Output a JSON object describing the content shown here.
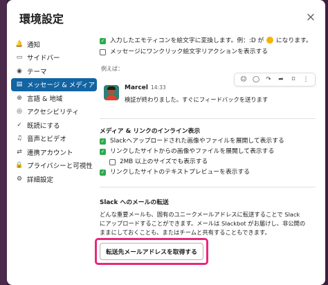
{
  "modal": {
    "title": "環境設定",
    "close_icon": "×"
  },
  "sidebar": {
    "items": [
      {
        "icon": "🔔",
        "label": "通知",
        "active": false
      },
      {
        "icon": "▭",
        "label": "サイドバー",
        "active": false
      },
      {
        "icon": "◉",
        "label": "テーマ",
        "active": false
      },
      {
        "icon": "▤",
        "label": "メッセージ & メディア",
        "active": true
      },
      {
        "icon": "⊕",
        "label": "言語 & 地域",
        "active": false
      },
      {
        "icon": "◎",
        "label": "アクセシビリティ",
        "active": false
      },
      {
        "icon": "✓",
        "label": "既読にする",
        "active": false
      },
      {
        "icon": "♫",
        "label": "音声とビデオ",
        "active": false
      },
      {
        "icon": "⇄",
        "label": "連携アカウント",
        "active": false
      },
      {
        "icon": "🔒",
        "label": "プライバシーと可視性",
        "active": false
      },
      {
        "icon": "⚙",
        "label": "詳細設定",
        "active": false
      }
    ]
  },
  "emoji": {
    "convert_text_before": "入力したエモティコンを絵文字に変換します。例：:D が",
    "convert_text_after": "になります。",
    "convert_checked": true,
    "one_click_label": "メッセージにワンクリック絵文字リアクションを表示する",
    "one_click_checked": false
  },
  "preview": {
    "label": "例えば：",
    "name": "Marcel",
    "time": "14:33",
    "text": "検証が終わりました。すぐにフィードバックを送ります",
    "actions": [
      "☺",
      "◯",
      "↷",
      "➦",
      "⌑",
      "⋮"
    ]
  },
  "inline": {
    "title": "メディア & リンクのインライン表示",
    "options": [
      {
        "label": "Slackへアップロードされた画像やファイルを展開して表示する",
        "checked": true,
        "indent": false
      },
      {
        "label": "リンクしたサイトからの画像やファイルを展開して表示する",
        "checked": true,
        "indent": false
      },
      {
        "label": "2MB 以上のサイズでも表示する",
        "checked": false,
        "indent": true
      },
      {
        "label": "リンクしたサイトのテキストプレビューを表示する",
        "checked": true,
        "indent": false
      }
    ]
  },
  "email": {
    "title": "Slack へのメールの転送",
    "description_lines": [
      "どんな重要メールも、固有のユニークメールアドレスに転送することで Slack",
      "にアップロードすることができます。メールは Slackbot がお届けし、非公開の",
      "ままにしておくことも、またはチームと共有することもできます。"
    ],
    "button_label": "転送先メールアドレスを取得する"
  },
  "colors": {
    "active_nav": "#1264a3",
    "checkbox_on": "#2eaa4f",
    "highlight": "#e8287c",
    "backdrop": "#3b1f3d"
  }
}
